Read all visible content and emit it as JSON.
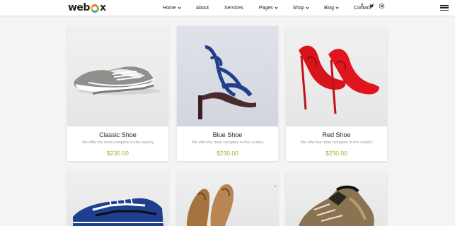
{
  "brand": {
    "logo_text_left": "web",
    "logo_text_right": "x"
  },
  "nav": {
    "items": [
      {
        "label": "Home",
        "dropdown": true
      },
      {
        "label": "About",
        "dropdown": false
      },
      {
        "label": "Services",
        "dropdown": false
      },
      {
        "label": "Pages",
        "dropdown": true
      },
      {
        "label": "Shop",
        "dropdown": true
      },
      {
        "label": "Blog",
        "dropdown": true
      },
      {
        "label": "Contact",
        "dropdown": false
      }
    ],
    "social": [
      "f",
      "t",
      "ig"
    ]
  },
  "colors": {
    "price": "#8cbc2f",
    "logo_ring": [
      "#f26c4f",
      "#7cc243",
      "#2d9ff0",
      "#f4b400"
    ]
  },
  "products": [
    {
      "name": "Classic Shoe",
      "desc": "We offer the most complete in the country",
      "price": "$230.00",
      "image": "grey-sneaker-image"
    },
    {
      "name": "Blue Shoe",
      "desc": "We offer the most complete in the country",
      "price": "$230.00",
      "image": "blue-heel-sandal-image"
    },
    {
      "name": "Red Shoe",
      "desc": "We offer the most complete in the country",
      "price": "$230.00",
      "image": "red-stiletto-image"
    },
    {
      "name": "",
      "desc": "",
      "price": "",
      "image": "blue-running-shoe-image"
    },
    {
      "name": "",
      "desc": "",
      "price": "",
      "image": "tan-heels-image"
    },
    {
      "name": "",
      "desc": "",
      "price": "",
      "image": "hiking-boot-image"
    }
  ]
}
